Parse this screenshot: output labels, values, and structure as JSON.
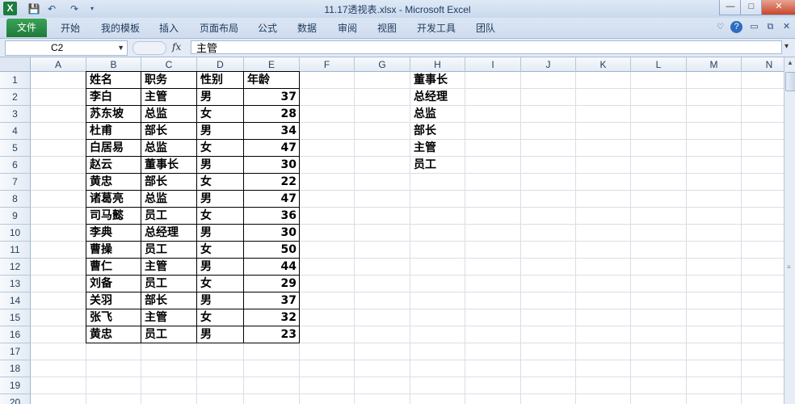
{
  "window": {
    "title": "11.17透视表.xlsx - Microsoft Excel",
    "min_label": "—",
    "max_label": "□",
    "close_label": "✕"
  },
  "qat": {
    "logo": "X",
    "save_icon": "save-icon",
    "undo_icon": "undo-icon",
    "redo_icon": "redo-icon"
  },
  "ribbon": {
    "file": "文件",
    "tabs": [
      "开始",
      "我的模板",
      "插入",
      "页面布局",
      "公式",
      "数据",
      "审阅",
      "视图",
      "开发工具",
      "团队"
    ]
  },
  "formula_bar": {
    "name_box": "C2",
    "fx": "fx",
    "value": "主管"
  },
  "columns": [
    "A",
    "B",
    "C",
    "D",
    "E",
    "F",
    "G",
    "H",
    "I",
    "J",
    "K",
    "L",
    "M",
    "N"
  ],
  "rows": [
    "1",
    "2",
    "3",
    "4",
    "5",
    "6",
    "7",
    "8",
    "9",
    "10",
    "11",
    "12",
    "13",
    "14",
    "15",
    "16",
    "17",
    "18",
    "19",
    "20"
  ],
  "table": {
    "headers": [
      "姓名",
      "职务",
      "性别",
      "年龄"
    ],
    "rows": [
      [
        "李白",
        "主管",
        "男",
        "37"
      ],
      [
        "苏东坡",
        "总监",
        "女",
        "28"
      ],
      [
        "杜甫",
        "部长",
        "男",
        "34"
      ],
      [
        "白居易",
        "总监",
        "女",
        "47"
      ],
      [
        "赵云",
        "董事长",
        "男",
        "30"
      ],
      [
        "黄忠",
        "部长",
        "女",
        "22"
      ],
      [
        "诸葛亮",
        "总监",
        "男",
        "47"
      ],
      [
        "司马懿",
        "员工",
        "女",
        "36"
      ],
      [
        "李典",
        "总经理",
        "男",
        "30"
      ],
      [
        "曹操",
        "员工",
        "女",
        "50"
      ],
      [
        "曹仁",
        "主管",
        "男",
        "44"
      ],
      [
        "刘备",
        "员工",
        "女",
        "29"
      ],
      [
        "关羽",
        "部长",
        "男",
        "37"
      ],
      [
        "张飞",
        "主管",
        "女",
        "32"
      ],
      [
        "黄忠",
        "员工",
        "男",
        "23"
      ]
    ]
  },
  "h_list": [
    "董事长",
    "总经理",
    "总监",
    "部长",
    "主管",
    "员工"
  ],
  "colors": {
    "file_tab": "#1f7a3a",
    "grid_line": "#d9dee6",
    "header_text": "#27415f"
  }
}
